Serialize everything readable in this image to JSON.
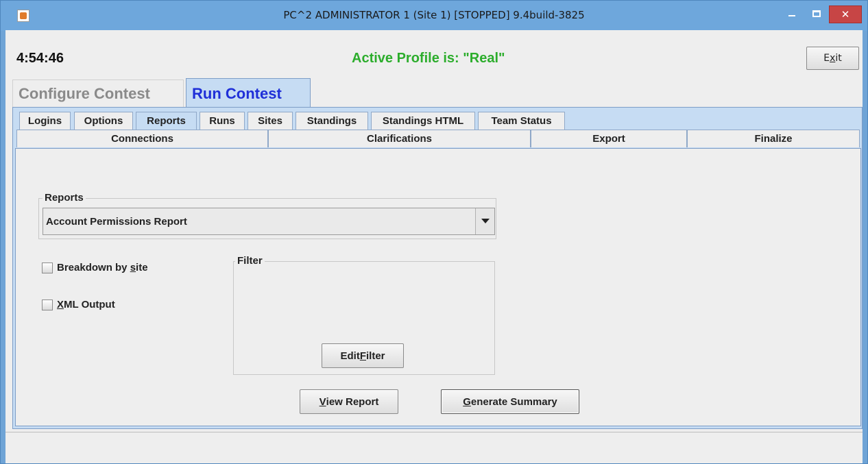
{
  "window": {
    "title": "PC^2 ADMINISTRATOR 1 (Site 1) [STOPPED] 9.4build-3825",
    "close_glyph": "✕"
  },
  "header": {
    "clock": "4:54:46",
    "profile": "Active Profile is: \"Real\"",
    "exit_pre": "E",
    "exit_mnemonic": "x",
    "exit_post": "it"
  },
  "main_tabs": [
    {
      "label": "Configure Contest",
      "selected": false
    },
    {
      "label": "Run Contest",
      "selected": true
    }
  ],
  "sub_tabs_row1": [
    {
      "label": "Logins"
    },
    {
      "label": "Options"
    },
    {
      "label": "Reports",
      "selected": true
    },
    {
      "label": "Runs"
    },
    {
      "label": "Sites"
    },
    {
      "label": "Standings"
    },
    {
      "label": "Standings HTML"
    },
    {
      "label": "Team Status"
    }
  ],
  "sub_tabs_row2": [
    {
      "label": "Connections"
    },
    {
      "label": "Clarifications"
    },
    {
      "label": "Export"
    },
    {
      "label": "Finalize"
    }
  ],
  "reports": {
    "group_title": "Reports",
    "selected_report": "Account Permissions Report"
  },
  "options": {
    "breakdown_pre": "Breakdown by ",
    "breakdown_mnemonic": "s",
    "breakdown_post": "ite",
    "breakdown_checked": false,
    "xml_mnemonic": "X",
    "xml_post": "ML Output",
    "xml_checked": false
  },
  "filter": {
    "group_title": "Filter",
    "edit_pre": "Edit ",
    "edit_mnemonic": "F",
    "edit_post": "ilter"
  },
  "actions": {
    "view_mnemonic": "V",
    "view_post": "iew Report",
    "generate_mnemonic": "G",
    "generate_post": "enerate Summary"
  },
  "colors": {
    "profile_text": "#2cad2c",
    "run_tab_text": "#1f2fd8",
    "tab_selected_bg": "#c6dcf3",
    "titlebar": "#6ea7dc",
    "close_button": "#c74545"
  }
}
